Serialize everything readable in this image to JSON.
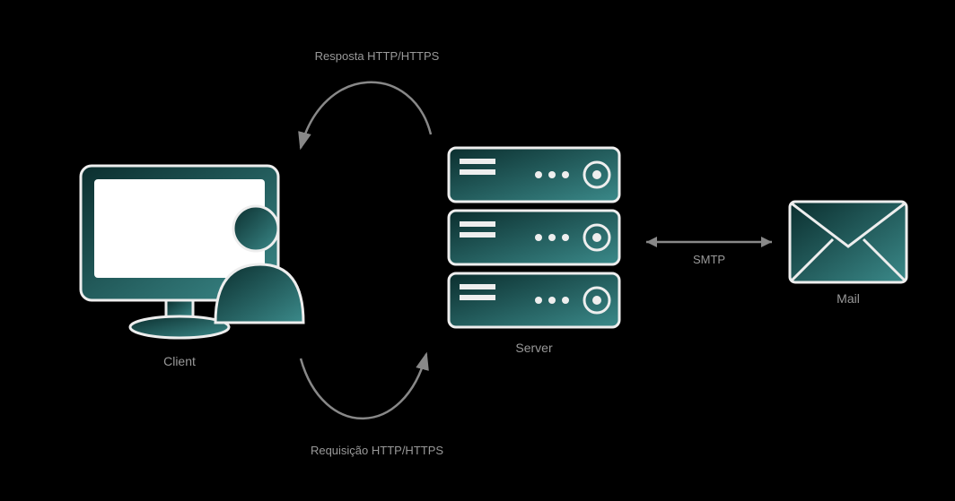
{
  "nodes": {
    "client": {
      "label": "Client"
    },
    "server": {
      "label": "Server"
    },
    "mail": {
      "label": "Mail"
    }
  },
  "arrows": {
    "response": {
      "label": "Resposta HTTP/HTTPS"
    },
    "request": {
      "label": "Requisição HTTP/HTTPS"
    },
    "smtp": {
      "label": "SMTP"
    }
  },
  "colors": {
    "grad_start": "#0a3a3a",
    "grad_end": "#3a8a8a",
    "stroke": "#eeeeee",
    "arrow": "#888888",
    "bg": "#000000"
  }
}
